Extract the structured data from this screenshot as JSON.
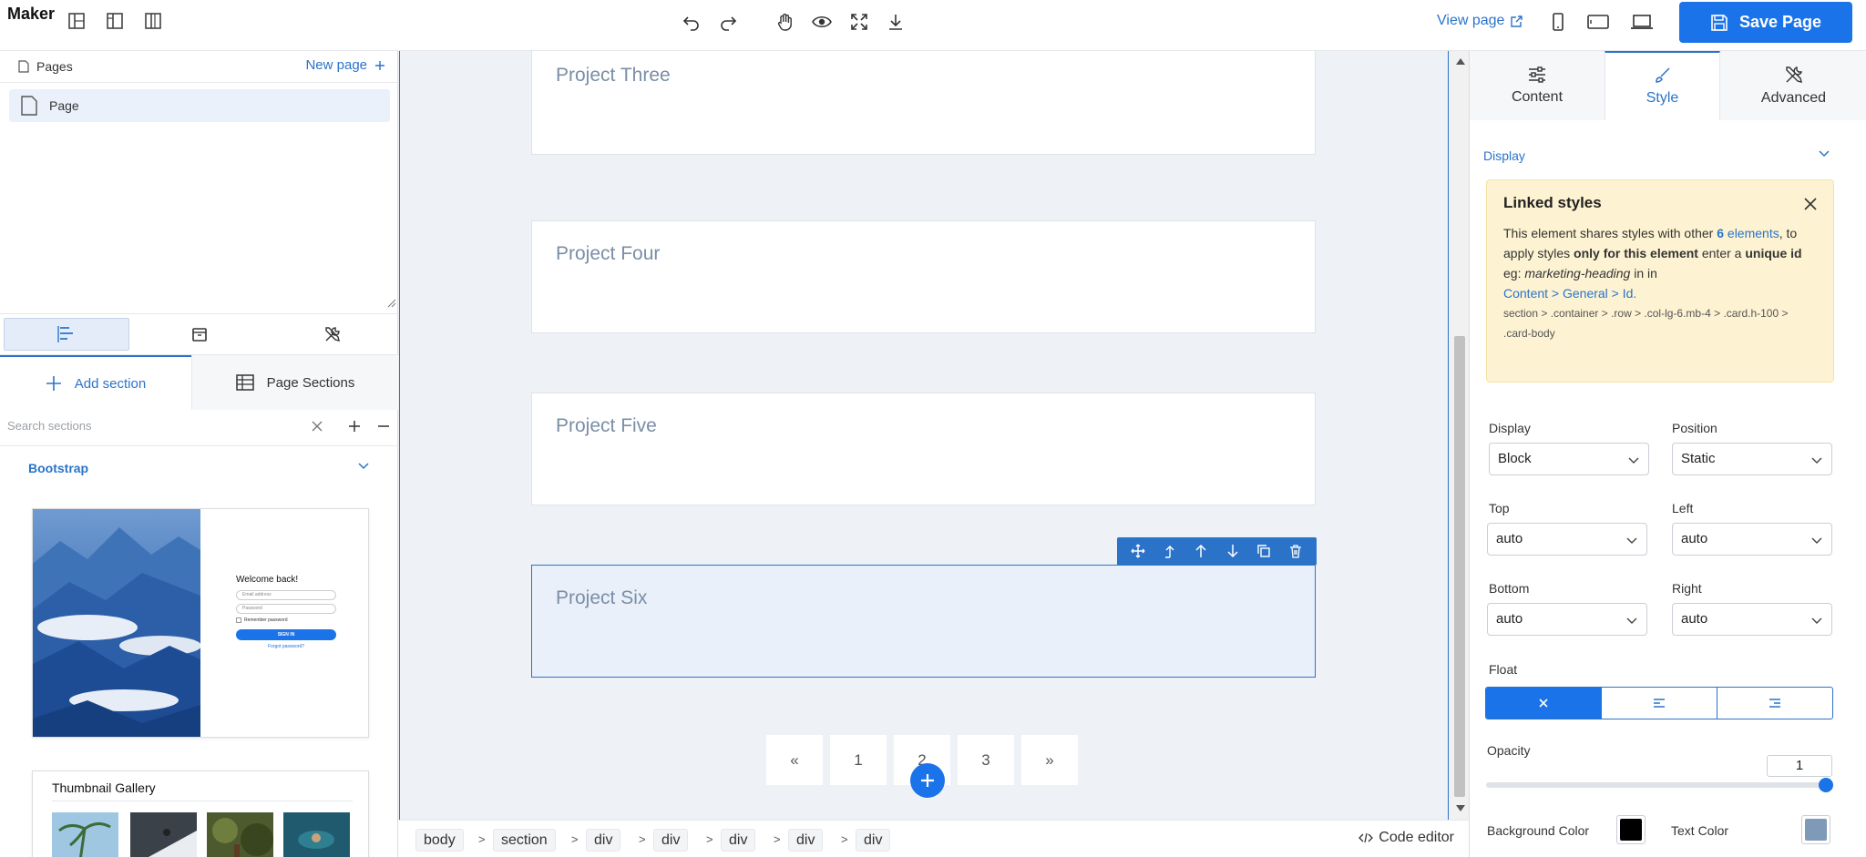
{
  "app": {
    "brand": "Maker"
  },
  "topbar": {
    "view_page": "View page",
    "save": "Save Page"
  },
  "pages": {
    "title": "Pages",
    "new_page": "New page",
    "items": [
      {
        "label": "Page"
      }
    ]
  },
  "sections_panel": {
    "tab_add": "Add section",
    "tab_page_sections": "Page Sections",
    "search_placeholder": "Search sections",
    "group": "Bootstrap",
    "login_thumb": {
      "welcome": "Welcome back!",
      "email": "Email address",
      "password": "Password",
      "remember": "Remember password",
      "signin": "SIGN IN",
      "forgot": "Forgot password?"
    },
    "gallery_title": "Thumbnail Gallery"
  },
  "canvas": {
    "cards": [
      {
        "title": "Project Three"
      },
      {
        "title": "Project Four"
      },
      {
        "title": "Project Five"
      },
      {
        "title": "Project Six"
      }
    ],
    "selected_card": "Project Six",
    "pagination": [
      "«",
      "1",
      "2",
      "3",
      "»"
    ]
  },
  "breadcrumbs": [
    "body",
    "section",
    "div",
    "div",
    "div",
    "div",
    "div"
  ],
  "breadcrumb_separator": ">",
  "code_editor": "Code editor",
  "right_panel": {
    "tabs": [
      "Content",
      "Style",
      "Advanced"
    ],
    "active_tab": "Style",
    "section": "Display",
    "linked": {
      "title": "Linked styles",
      "t1": "This element shares styles with other ",
      "count": "6",
      "t2": "elements",
      "t3": ", to apply styles ",
      "t4": "only for this element",
      "t5": " enter a ",
      "t6": "unique id",
      "t7": " eg: ",
      "t8": "marketing-heading",
      "t9": " in in",
      "link": "Content > General > Id.",
      "path": "section > .container > .row > .col-lg-6.mb-4 > .card.h-100 > .card-body"
    },
    "fields": {
      "display_label": "Display",
      "display_value": "Block",
      "position_label": "Position",
      "position_value": "Static",
      "top_label": "Top",
      "top_value": "auto",
      "left_label": "Left",
      "left_value": "auto",
      "bottom_label": "Bottom",
      "bottom_value": "auto",
      "right_label": "Right",
      "right_value": "auto",
      "float_label": "Float",
      "opacity_label": "Opacity",
      "opacity_value": "1",
      "bg_color_label": "Background Color",
      "bg_color": "#000000",
      "text_color_label": "Text Color",
      "text_color": "#7f9ab8"
    }
  },
  "colors": {
    "accent": "#1a73e8",
    "link": "#2b73c9",
    "canvas_bg": "#eef2f7",
    "notice_bg": "#fdf3d2"
  }
}
